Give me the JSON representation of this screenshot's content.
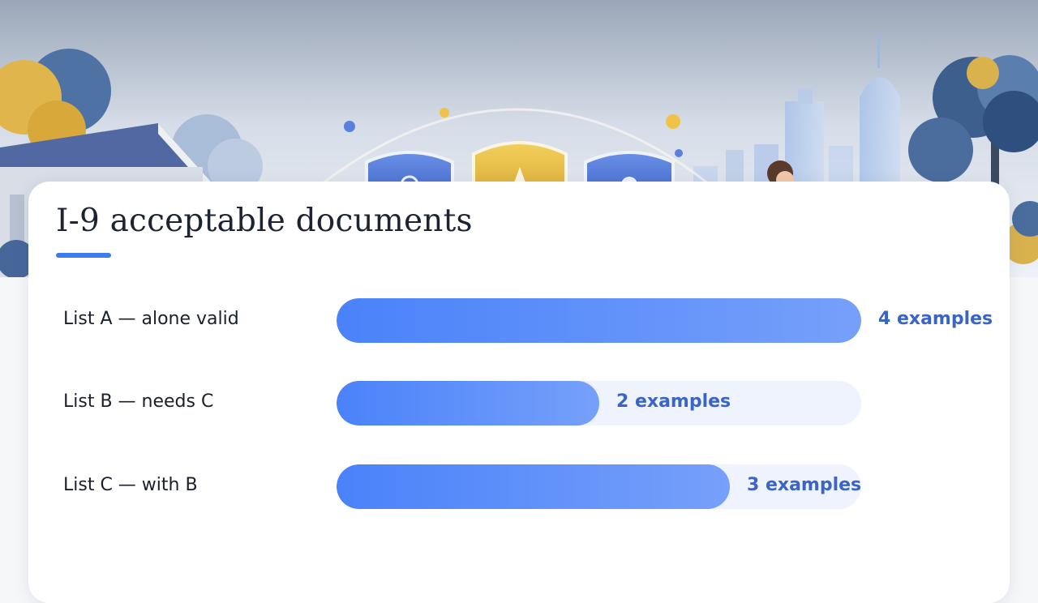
{
  "title": "I-9 acceptable documents",
  "colors": {
    "accent": "#3d7bf0",
    "bar_start": "#4a82fa",
    "bar_end": "#76a0fa",
    "track": "#eef3fe",
    "value_text": "#3a64c8"
  },
  "chart_data": {
    "type": "bar",
    "orientation": "horizontal",
    "categories": [
      "List A — alone valid",
      "List B — needs C",
      "List C — with B"
    ],
    "values": [
      4,
      2,
      3
    ],
    "value_labels": [
      "4 examples",
      "2 examples",
      "3 examples"
    ],
    "title": "I-9 acceptable documents",
    "xlim": [
      0,
      4
    ],
    "grid": false
  }
}
